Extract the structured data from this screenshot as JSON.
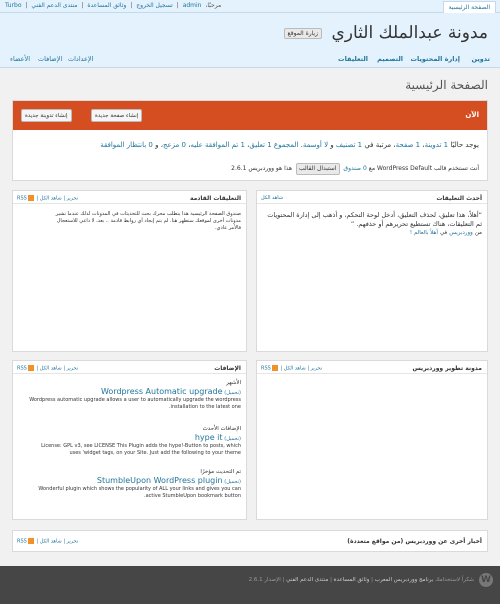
{
  "topbar": {
    "home_tab": "الصفحة الرئيسية",
    "turbo": "Turbo",
    "support_forums": "منتدى الدعم الفني",
    "documentation": "وثائق المساعدة",
    "logout": "تسجيل الخروج",
    "howdy": "مرحبًا،",
    "username": "admin",
    "sep": "|"
  },
  "header": {
    "blog_name": "مدونة عبدالملك الثاري",
    "visit_site": "زيارة الموقع"
  },
  "main_nav": {
    "items": [
      "تدوين",
      "إدارة المحتويات",
      "التصميم",
      "التعليقات"
    ],
    "secondary": [
      "الإعدادات",
      "الإضافات",
      "الأعضاء"
    ]
  },
  "page_title": "الصفحة الرئيسية",
  "right_now": {
    "title": "الآن",
    "write_post": "إنشاء تدوينة جديدة",
    "write_page": "إنشاء صفحة جديدة",
    "stats_prefix": "يوجد حاليًا",
    "posts": "1 تدوينة",
    "pages": "1 صفحة",
    "cats": "1 تصنيف",
    "tags": "لا أوسمة",
    "stats_mid": "، مرتبة في",
    "stats_and": "، و",
    "stats_total": "المجموع",
    "comments": "1 تعليق",
    "approved": "1 تم الموافقة عليه",
    "spam": "0 مزعج",
    "pending": "0 بانتظار الموافقة",
    "theme_prefix": "أنت تستخدم قالب WordPress Default مع",
    "widgets": "0 صندوق",
    "change_theme": "استبدال القالب",
    "version": "هذا هو ووردبريس 2.6.1"
  },
  "widgets": {
    "recent_comments": {
      "title": "أحدث التعليقات",
      "see_all": "شاهد الكل",
      "comment": "“أهلاً، هذا تعليق، لحذف التعليق، أدخل لوحة التحكم، و أذهب إلى إدارة المحتويات ثم التعليقات، هناك تستطيع تحريرهم أو حذفهم. ”",
      "from": "من",
      "author": "ووردبريس",
      "on": "في",
      "post": "أهلاً بالعالم !"
    },
    "incoming_links": {
      "title": "التعليقات القادمة",
      "see_all": "شاهد الكل",
      "edit": "تحرير",
      "rss": "RSS",
      "text": "صندوق الصفحة الرئيسية هذا يتطلب محرك بحث للتحديثات في المدونات لذلك عندما تشير مدونات أخرى لموقعك ستظهر هنا. لم يتم إيجاد أي روابط قادمة .. بعد، لا داعي للاستعجال فالأمر عادي."
    },
    "dev_blog": {
      "title": "مدونة تطوير ووردبريس",
      "see_all": "شاهد الكل",
      "edit": "تحرير",
      "rss": "RSS"
    },
    "plugins": {
      "title": "الإضافات",
      "see_all": "شاهد الكل",
      "edit": "تحرير",
      "rss": "RSS",
      "items": [
        {
          "heading": "الأشهر",
          "name": "Wordpress Automatic upgrade",
          "install": "(تحميل)",
          "desc": "Wordpress automatic upgrade allows a user to automatically upgrade the wordpress installation to the latest one."
        },
        {
          "heading": "الإضافات الأحدث",
          "name": "hype it",
          "install": "(تحميل)",
          "desc": "License: GPL v3, see LICENSE This Plugin adds the hype!-Button to posts, which uses 'widget tags, on your Site. Just add the following to your theme"
        },
        {
          "heading": "تم التحديث مؤخرًا",
          "name": "StumbleUpon WordPress plugin",
          "install": "(تحميل)",
          "desc": "Wonderful plugin which shows the popularity of ALL your links and gives you can active StumbleUpon bookmark button."
        }
      ]
    },
    "planet": {
      "title": "أخبار أخرى عن ووردبريس (من مواقع متعددة)",
      "see_all": "شاهد الكل",
      "edit": "تحرير",
      "rss": "RSS"
    }
  },
  "footer": {
    "thanks": "شكراً لاستخدامك",
    "wordpress": "برنامج ووردبريس المعرب",
    "docs": "وثائق المساعدة",
    "forums": "منتدى الدعم الفني",
    "version": "الإصدار 2.6.1",
    "sep": "|"
  }
}
